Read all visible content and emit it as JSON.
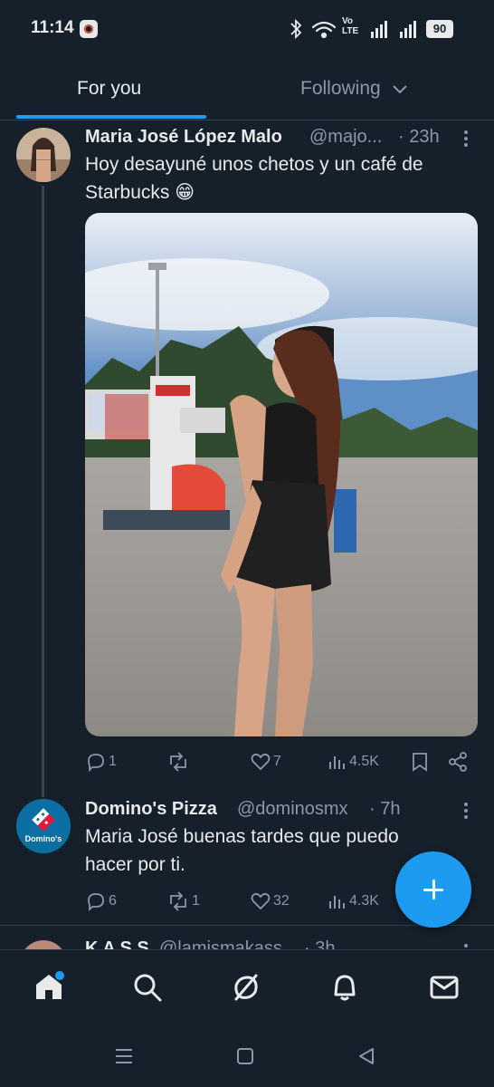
{
  "status_bar": {
    "time": "11:14",
    "network_label": "Vo LTE",
    "battery": "90"
  },
  "tabs": [
    {
      "label": "For you",
      "active": true
    },
    {
      "label": "Following",
      "active": false
    }
  ],
  "tweets": [
    {
      "name": "Maria José López Malo",
      "handle": "@majo...",
      "time": "· 23h",
      "text": "Hoy desayuné unos chetos y un café de Starbucks 😁",
      "actions": {
        "replies": "1",
        "retweets": "",
        "likes": "7",
        "views": "4.5K"
      }
    },
    {
      "name": "Domino's Pizza",
      "handle": "@dominosmx",
      "time": "· 7h",
      "text": "Maria José buenas tardes que puedo hacer por ti.",
      "logo_text": "Domino's",
      "actions": {
        "replies": "6",
        "retweets": "1",
        "likes": "32",
        "views": "4.3K"
      }
    },
    {
      "name": "K A S S",
      "handle": "@lamismakass",
      "time": "· 3h"
    }
  ],
  "bottom_nav": [
    "home-icon",
    "search-icon",
    "grok-icon",
    "notifications-icon",
    "messages-icon"
  ],
  "colors": {
    "background": "#15202b",
    "accent": "#1d9bf0",
    "secondary_text": "#8b98a5"
  }
}
